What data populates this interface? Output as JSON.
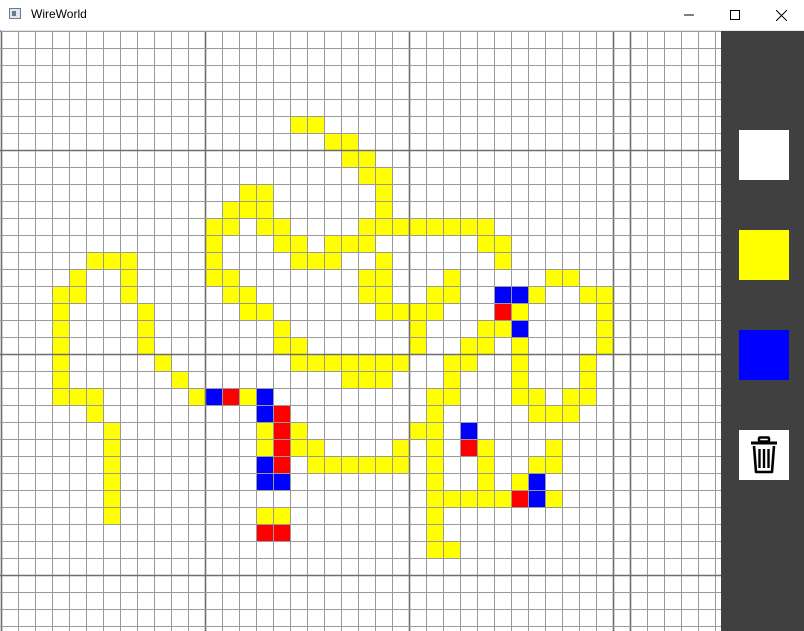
{
  "window": {
    "title": "WireWorld",
    "controls": [
      "minimize-icon",
      "maximize-icon",
      "close-icon"
    ]
  },
  "grid": {
    "cols": 42,
    "rows": 35,
    "cell_size": 17,
    "colors": {
      "background": "#ffffff",
      "gridline": "#9a9a9a",
      "major_gridline": "#6e6e6e",
      "conductor": "#ffff00",
      "electron_head": "#0000ff",
      "electron_tail": "#ff0000"
    },
    "cells": {
      "conductor": [
        [
          17,
          5
        ],
        [
          18,
          5
        ],
        [
          19,
          6
        ],
        [
          20,
          6
        ],
        [
          20,
          7
        ],
        [
          21,
          7
        ],
        [
          21,
          8
        ],
        [
          22,
          8
        ],
        [
          14,
          9
        ],
        [
          15,
          9
        ],
        [
          22,
          9
        ],
        [
          13,
          10
        ],
        [
          14,
          10
        ],
        [
          15,
          10
        ],
        [
          22,
          10
        ],
        [
          12,
          11
        ],
        [
          13,
          11
        ],
        [
          15,
          11
        ],
        [
          16,
          11
        ],
        [
          21,
          11
        ],
        [
          22,
          11
        ],
        [
          23,
          11
        ],
        [
          24,
          11
        ],
        [
          25,
          11
        ],
        [
          26,
          11
        ],
        [
          27,
          11
        ],
        [
          28,
          11
        ],
        [
          12,
          12
        ],
        [
          16,
          12
        ],
        [
          17,
          12
        ],
        [
          19,
          12
        ],
        [
          20,
          12
        ],
        [
          21,
          12
        ],
        [
          28,
          12
        ],
        [
          29,
          12
        ],
        [
          5,
          13
        ],
        [
          6,
          13
        ],
        [
          7,
          13
        ],
        [
          12,
          13
        ],
        [
          17,
          13
        ],
        [
          18,
          13
        ],
        [
          19,
          13
        ],
        [
          22,
          13
        ],
        [
          29,
          13
        ],
        [
          4,
          14
        ],
        [
          7,
          14
        ],
        [
          12,
          14
        ],
        [
          13,
          14
        ],
        [
          21,
          14
        ],
        [
          22,
          14
        ],
        [
          26,
          14
        ],
        [
          32,
          14
        ],
        [
          33,
          14
        ],
        [
          3,
          15
        ],
        [
          4,
          15
        ],
        [
          7,
          15
        ],
        [
          13,
          15
        ],
        [
          14,
          15
        ],
        [
          21,
          15
        ],
        [
          22,
          15
        ],
        [
          25,
          15
        ],
        [
          26,
          15
        ],
        [
          31,
          15
        ],
        [
          34,
          15
        ],
        [
          35,
          15
        ],
        [
          3,
          16
        ],
        [
          8,
          16
        ],
        [
          14,
          16
        ],
        [
          15,
          16
        ],
        [
          22,
          16
        ],
        [
          23,
          16
        ],
        [
          24,
          16
        ],
        [
          25,
          16
        ],
        [
          29,
          16
        ],
        [
          30,
          16
        ],
        [
          35,
          16
        ],
        [
          3,
          17
        ],
        [
          8,
          17
        ],
        [
          16,
          17
        ],
        [
          24,
          17
        ],
        [
          28,
          17
        ],
        [
          29,
          17
        ],
        [
          35,
          17
        ],
        [
          3,
          18
        ],
        [
          8,
          18
        ],
        [
          16,
          18
        ],
        [
          17,
          18
        ],
        [
          24,
          18
        ],
        [
          27,
          18
        ],
        [
          28,
          18
        ],
        [
          30,
          18
        ],
        [
          35,
          18
        ],
        [
          3,
          19
        ],
        [
          9,
          19
        ],
        [
          17,
          19
        ],
        [
          18,
          19
        ],
        [
          19,
          19
        ],
        [
          20,
          19
        ],
        [
          21,
          19
        ],
        [
          22,
          19
        ],
        [
          23,
          19
        ],
        [
          26,
          19
        ],
        [
          27,
          19
        ],
        [
          30,
          19
        ],
        [
          34,
          19
        ],
        [
          3,
          20
        ],
        [
          10,
          20
        ],
        [
          20,
          20
        ],
        [
          21,
          20
        ],
        [
          22,
          20
        ],
        [
          26,
          20
        ],
        [
          30,
          20
        ],
        [
          34,
          20
        ],
        [
          3,
          21
        ],
        [
          4,
          21
        ],
        [
          5,
          21
        ],
        [
          11,
          21
        ],
        [
          12,
          21
        ],
        [
          14,
          21
        ],
        [
          25,
          21
        ],
        [
          26,
          21
        ],
        [
          30,
          21
        ],
        [
          31,
          21
        ],
        [
          33,
          21
        ],
        [
          34,
          21
        ],
        [
          5,
          22
        ],
        [
          25,
          22
        ],
        [
          31,
          22
        ],
        [
          32,
          22
        ],
        [
          33,
          22
        ],
        [
          6,
          23
        ],
        [
          15,
          23
        ],
        [
          17,
          23
        ],
        [
          24,
          23
        ],
        [
          25,
          23
        ],
        [
          6,
          24
        ],
        [
          15,
          24
        ],
        [
          17,
          24
        ],
        [
          18,
          24
        ],
        [
          23,
          24
        ],
        [
          25,
          24
        ],
        [
          28,
          24
        ],
        [
          32,
          24
        ],
        [
          6,
          25
        ],
        [
          18,
          25
        ],
        [
          19,
          25
        ],
        [
          20,
          25
        ],
        [
          21,
          25
        ],
        [
          22,
          25
        ],
        [
          23,
          25
        ],
        [
          25,
          25
        ],
        [
          28,
          25
        ],
        [
          31,
          25
        ],
        [
          32,
          25
        ],
        [
          6,
          26
        ],
        [
          25,
          26
        ],
        [
          28,
          26
        ],
        [
          30,
          26
        ],
        [
          6,
          27
        ],
        [
          25,
          27
        ],
        [
          26,
          27
        ],
        [
          27,
          27
        ],
        [
          28,
          27
        ],
        [
          29,
          27
        ],
        [
          32,
          27
        ],
        [
          6,
          28
        ],
        [
          15,
          28
        ],
        [
          16,
          28
        ],
        [
          25,
          28
        ],
        [
          25,
          29
        ],
        [
          25,
          30
        ],
        [
          26,
          30
        ]
      ],
      "head": [
        [
          29,
          15
        ],
        [
          30,
          15
        ],
        [
          30,
          17
        ],
        [
          12,
          21
        ],
        [
          15,
          21
        ],
        [
          15,
          22
        ],
        [
          27,
          23
        ],
        [
          15,
          25
        ],
        [
          15,
          26
        ],
        [
          16,
          26
        ],
        [
          31,
          26
        ],
        [
          31,
          27
        ]
      ],
      "tail": [
        [
          29,
          16
        ],
        [
          13,
          21
        ],
        [
          16,
          22
        ],
        [
          16,
          23
        ],
        [
          16,
          24
        ],
        [
          27,
          24
        ],
        [
          16,
          25
        ],
        [
          30,
          27
        ],
        [
          15,
          29
        ],
        [
          16,
          29
        ]
      ]
    }
  },
  "sidebar": {
    "tools": [
      {
        "name": "empty",
        "color": "#ffffff"
      },
      {
        "name": "conductor",
        "color": "#ffff00"
      },
      {
        "name": "electron-head",
        "color": "#0000ff"
      },
      {
        "name": "clear",
        "icon": "trash-icon"
      }
    ]
  }
}
